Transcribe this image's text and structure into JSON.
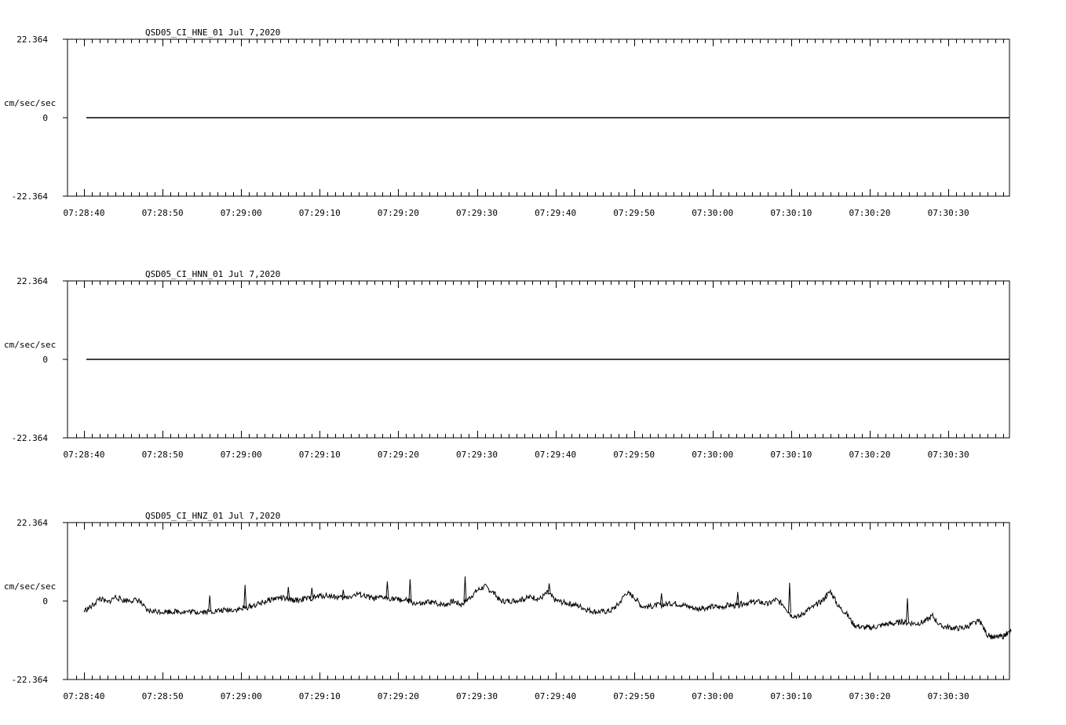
{
  "chart_data": [
    {
      "type": "line",
      "title": "QSD05_CI_HNE_01  Jul 7,2020",
      "ylabel": "cm/sec/sec",
      "ylim": [
        -22.364,
        22.364
      ],
      "y_tick_labels": [
        "22.364",
        "0",
        "-22.364"
      ],
      "x_tick_labels": [
        "07:28:40",
        "07:28:50",
        "07:29:00",
        "07:29:10",
        "07:29:20",
        "07:29:30",
        "07:29:40",
        "07:29:50",
        "07:30:00",
        "07:30:10",
        "07:30:20",
        "07:30:30"
      ],
      "x_seconds_range": [
        -1,
        118
      ],
      "series": [
        {
          "t": [
            0,
            118
          ],
          "values": [
            0,
            0
          ]
        }
      ]
    },
    {
      "type": "line",
      "title": "QSD05_CI_HNN_01  Jul 7,2020",
      "ylabel": "cm/sec/sec",
      "ylim": [
        -22.364,
        22.364
      ],
      "y_tick_labels": [
        "22.364",
        "0",
        "-22.364"
      ],
      "x_tick_labels": [
        "07:28:40",
        "07:28:50",
        "07:29:00",
        "07:29:10",
        "07:29:20",
        "07:29:30",
        "07:29:40",
        "07:29:50",
        "07:30:00",
        "07:30:10",
        "07:30:20",
        "07:30:30"
      ],
      "x_seconds_range": [
        -1,
        118
      ],
      "series": [
        {
          "t": [
            0,
            118
          ],
          "values": [
            0,
            0
          ]
        }
      ]
    },
    {
      "type": "line",
      "title": "QSD05_CI_HNZ_01  Jul 7,2020",
      "ylabel": "cm/sec/sec",
      "ylim": [
        -22.364,
        22.364
      ],
      "y_tick_labels": [
        "22.364",
        "0",
        "-22.364"
      ],
      "x_tick_labels": [
        "07:28:40",
        "07:28:50",
        "07:29:00",
        "07:29:10",
        "07:29:20",
        "07:29:30",
        "07:29:40",
        "07:29:50",
        "07:30:00",
        "07:30:10",
        "07:30:20",
        "07:30:30"
      ],
      "x_seconds_range": [
        -1,
        118
      ],
      "series": [
        {
          "t": [
            0,
            1,
            2,
            3,
            4,
            5,
            6,
            7,
            8,
            10,
            12,
            14,
            16,
            18,
            20,
            22,
            24,
            25,
            26,
            27,
            28,
            29,
            30,
            31,
            32,
            33,
            34,
            35,
            36,
            37,
            38,
            39,
            40,
            41,
            42,
            43,
            44,
            45,
            46,
            47,
            48,
            49,
            50,
            51,
            52,
            53,
            54,
            55,
            56,
            57,
            58,
            59,
            60,
            61,
            62,
            63,
            64,
            65,
            66,
            67,
            68,
            69,
            70,
            71,
            72,
            73,
            74,
            75,
            76,
            77,
            78,
            79,
            80,
            81,
            82,
            83,
            84,
            85,
            86,
            87,
            88,
            89,
            90,
            91,
            92,
            93,
            94,
            95,
            96,
            97,
            98,
            99,
            100,
            101,
            102,
            103,
            104,
            105,
            106,
            107,
            108,
            109,
            110,
            111,
            112,
            113,
            114,
            115,
            116,
            117,
            118
          ],
          "values": [
            -2.8,
            -1.5,
            0.8,
            -0.5,
            1.2,
            0.2,
            0.2,
            0.2,
            -2.8,
            -3.0,
            -3.0,
            -3.1,
            -3.0,
            -2.6,
            -2.3,
            -1.0,
            0.6,
            1.0,
            0.4,
            0.2,
            0.6,
            0.8,
            1.4,
            1.6,
            1.2,
            0.8,
            1.4,
            2.0,
            1.2,
            0.6,
            1.0,
            0.8,
            0.4,
            0.2,
            -0.6,
            -1.0,
            -0.2,
            -0.8,
            -1.0,
            0.0,
            -1.0,
            0.8,
            3.0,
            4.2,
            2.6,
            0.0,
            0.0,
            0.2,
            0.6,
            1.2,
            0.6,
            2.4,
            0.2,
            -0.4,
            -0.8,
            -1.4,
            -2.4,
            -3.0,
            -3.0,
            -2.8,
            -1.0,
            2.4,
            1.2,
            -1.5,
            -1.6,
            -1.2,
            -1.0,
            -0.6,
            -1.0,
            -1.6,
            -2.2,
            -2.0,
            -1.6,
            -1.8,
            -1.2,
            -1.4,
            -0.6,
            -0.4,
            -0.2,
            -1.0,
            0.4,
            -1.0,
            -4.0,
            -4.5,
            -2.6,
            -1.5,
            0.2,
            2.8,
            -1.5,
            -3.5,
            -6.8,
            -7.5,
            -7.6,
            -7.2,
            -6.6,
            -6.4,
            -6.0,
            -6.2,
            -6.4,
            -5.8,
            -4.2,
            -7.2,
            -7.4,
            -7.8,
            -7.6,
            -6.6,
            -5.8,
            -9.8,
            -10.4,
            -10.0,
            -8.6
          ],
          "spikes": [
            {
              "t": 16,
              "value": 1.6
            },
            {
              "t": 20.5,
              "value": 4.6
            },
            {
              "t": 26,
              "value": 4.0
            },
            {
              "t": 29,
              "value": 3.8
            },
            {
              "t": 33,
              "value": 3.2
            },
            {
              "t": 38.6,
              "value": 5.6
            },
            {
              "t": 41.5,
              "value": 6.2
            },
            {
              "t": 48.5,
              "value": 7.0
            },
            {
              "t": 59.2,
              "value": 5.0
            },
            {
              "t": 73.5,
              "value": 2.2
            },
            {
              "t": 83.2,
              "value": 2.6
            },
            {
              "t": 89.8,
              "value": 5.2
            },
            {
              "t": 94.5,
              "value": 2.2
            },
            {
              "t": 104.8,
              "value": 0.8
            }
          ]
        }
      ]
    }
  ]
}
